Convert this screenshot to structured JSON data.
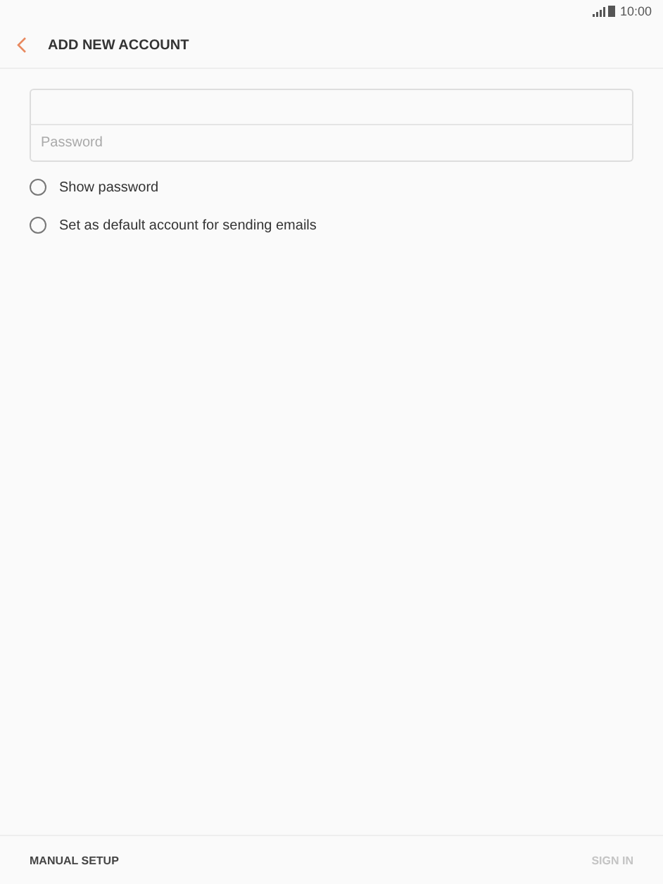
{
  "status_bar": {
    "time": "10:00"
  },
  "header": {
    "title": "ADD NEW ACCOUNT"
  },
  "form": {
    "password": {
      "placeholder": "Password"
    }
  },
  "options": [
    {
      "label": "Show password",
      "checked": false
    },
    {
      "label": "Set as default account for sending emails",
      "checked": false
    }
  ],
  "footer": {
    "left": {
      "label": "MANUAL SETUP",
      "disabled": false
    },
    "right": {
      "label": "SIGN IN",
      "disabled": true
    }
  }
}
